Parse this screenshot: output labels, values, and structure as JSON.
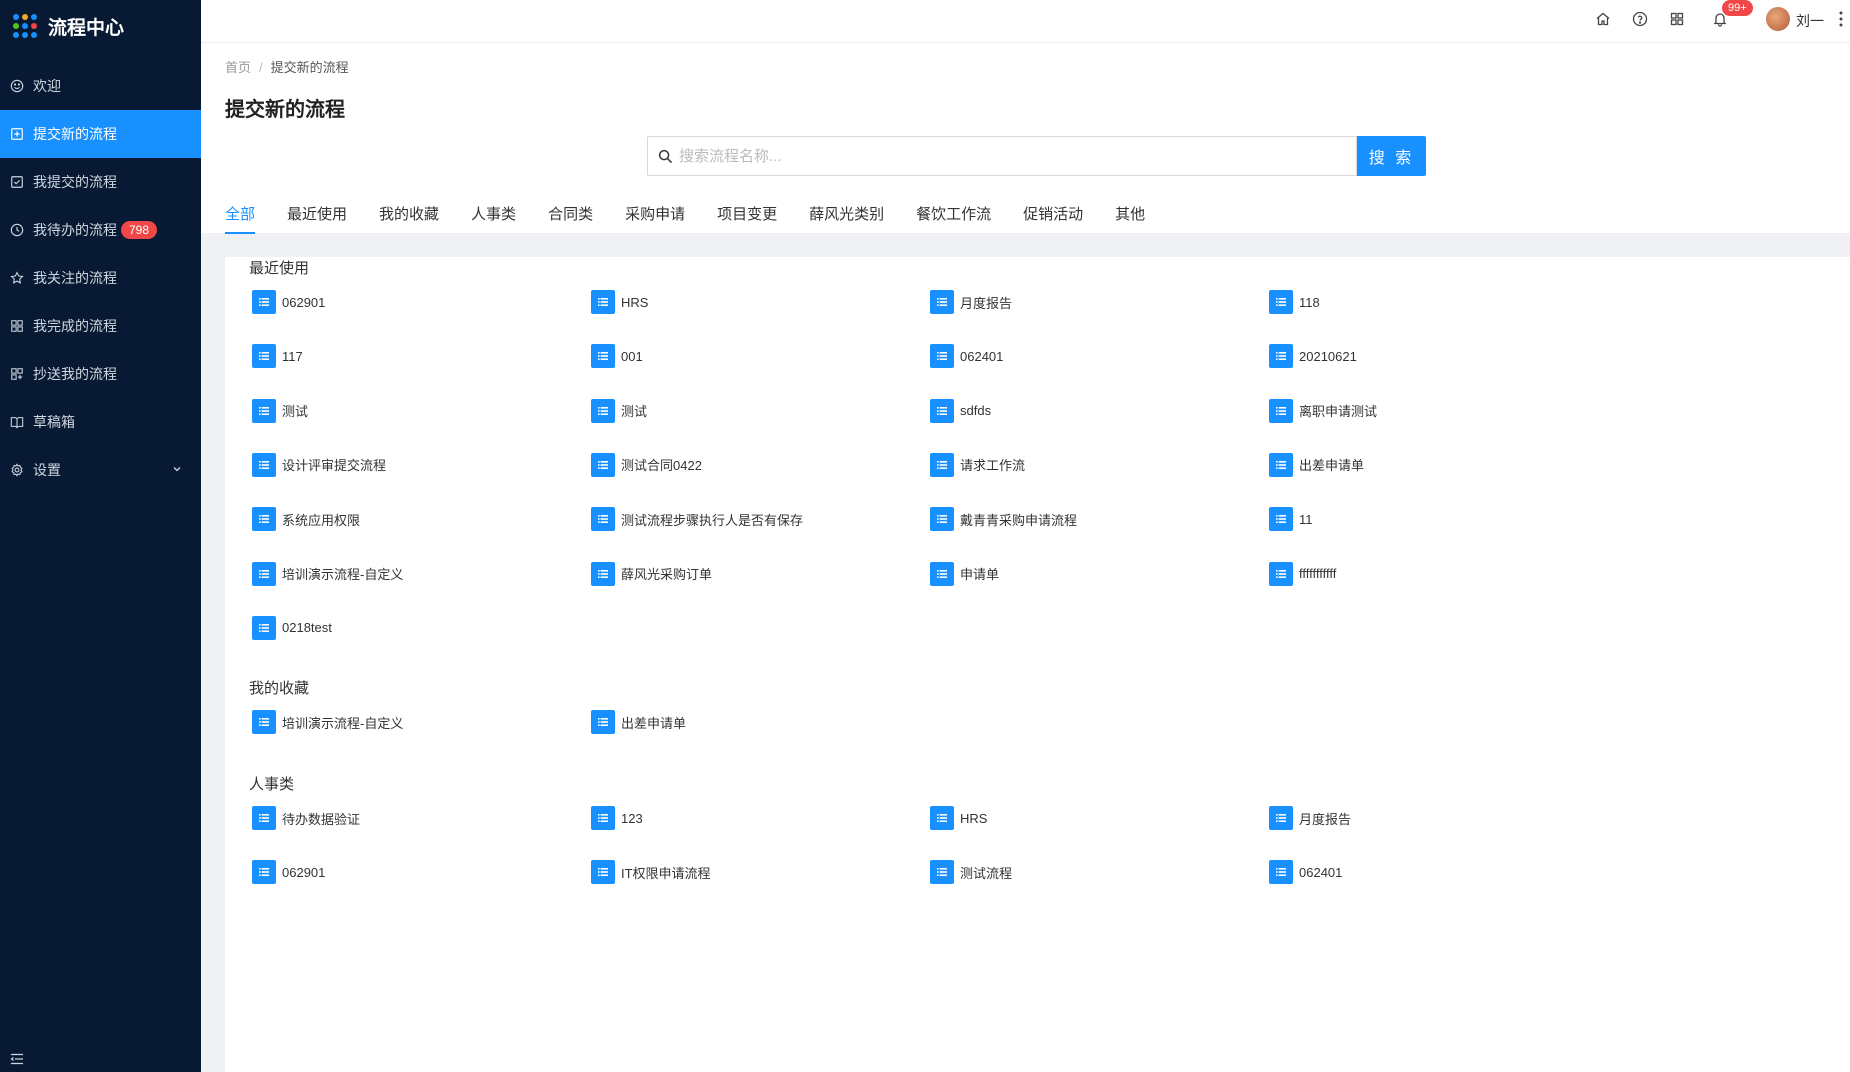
{
  "app": {
    "title": "流程中心",
    "logo_dot_colors": [
      "#1890ff",
      "#f5a623",
      "#1890ff",
      "#52c41a",
      "#1890ff",
      "#f04848",
      "#1890ff",
      "#1890ff",
      "#1890ff"
    ]
  },
  "sidebar": {
    "items": [
      {
        "label": "欢迎",
        "icon": "smile-icon"
      },
      {
        "label": "提交新的流程",
        "icon": "plus-square-icon",
        "active": true
      },
      {
        "label": "我提交的流程",
        "icon": "check-square-icon"
      },
      {
        "label": "我待办的流程",
        "icon": "clock-icon",
        "badge": "798"
      },
      {
        "label": "我关注的流程",
        "icon": "star-icon"
      },
      {
        "label": "我完成的流程",
        "icon": "appstore-icon"
      },
      {
        "label": "抄送我的流程",
        "icon": "copy-icon"
      },
      {
        "label": "草稿箱",
        "icon": "book-icon"
      },
      {
        "label": "设置",
        "icon": "gear-icon",
        "expandable": true
      }
    ]
  },
  "topbar": {
    "notification_badge": "99+",
    "username": "刘一"
  },
  "breadcrumb": {
    "home": "首页",
    "separator": "/",
    "current": "提交新的流程"
  },
  "page_title": "提交新的流程",
  "search": {
    "placeholder": "搜索流程名称...",
    "value": "",
    "button_label": "搜 索"
  },
  "tabs": [
    "全部",
    "最近使用",
    "我的收藏",
    "人事类",
    "合同类",
    "采购申请",
    "项目变更",
    "薛风光类别",
    "餐饮工作流",
    "促销活动",
    "其他"
  ],
  "active_tab": "全部",
  "sections": [
    {
      "title": "最近使用",
      "items": [
        "062901",
        "HRS",
        "月度报告",
        "118",
        "117",
        "001",
        "062401",
        "20210621",
        "测试",
        "测试",
        "sdfds",
        "离职申请测试",
        "设计评审提交流程",
        "测试合同0422",
        "请求工作流",
        "出差申请单",
        "系统应用权限",
        "测试流程步骤执行人是否有保存",
        "戴青青采购申请流程",
        "11",
        "培训演示流程-自定义",
        "薛风光采购订单",
        "申请单",
        "fffffffffff",
        "0218test"
      ]
    },
    {
      "title": "我的收藏",
      "items": [
        "培训演示流程-自定义",
        "出差申请单"
      ]
    },
    {
      "title": "人事类",
      "items": [
        "待办数据验证",
        "123",
        "HRS",
        "月度报告",
        "062901",
        "IT权限申请流程",
        "测试流程",
        "062401"
      ]
    }
  ],
  "colors": {
    "sidebar_bg": "#081a33",
    "accent": "#1890ff",
    "badge": "#f04848"
  }
}
